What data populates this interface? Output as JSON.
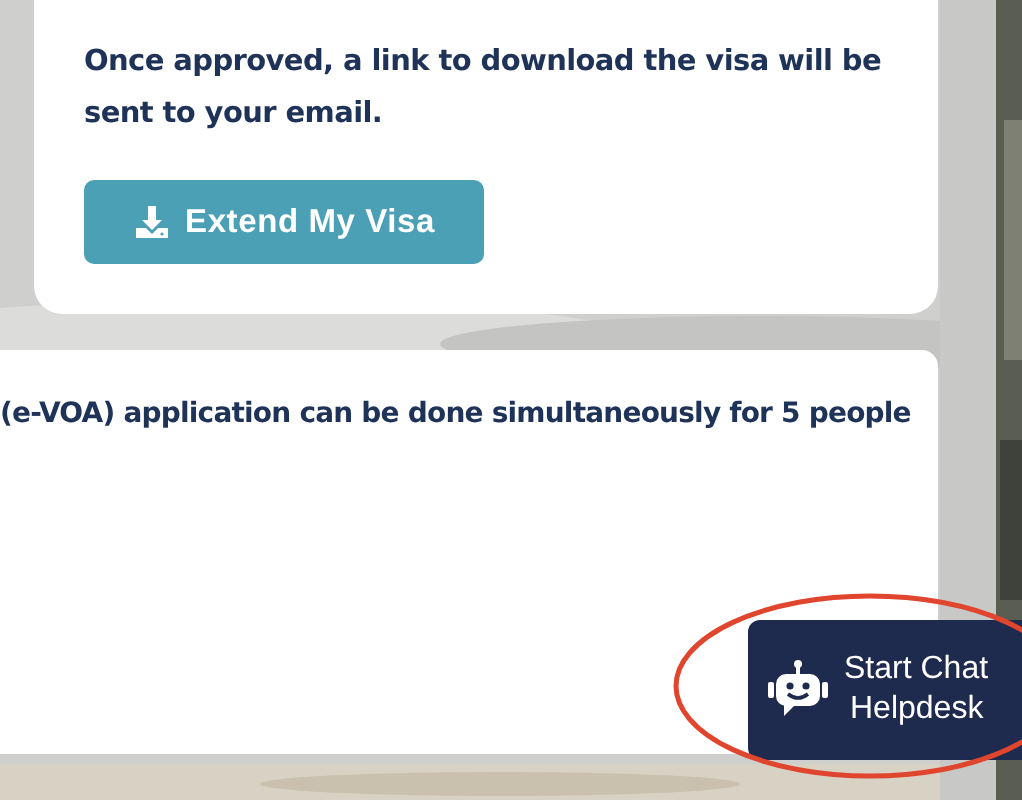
{
  "approval_card": {
    "message": "Once approved, a link to download the visa will be sent to your email.",
    "button": {
      "label": "Extend My Visa"
    }
  },
  "info_card": {
    "text": "(e-VOA) application can be done simultaneously for 5 people"
  },
  "chat_widget": {
    "line_1": "Start Chat",
    "line_2": "Helpdesk",
    "highlighted": true
  }
}
